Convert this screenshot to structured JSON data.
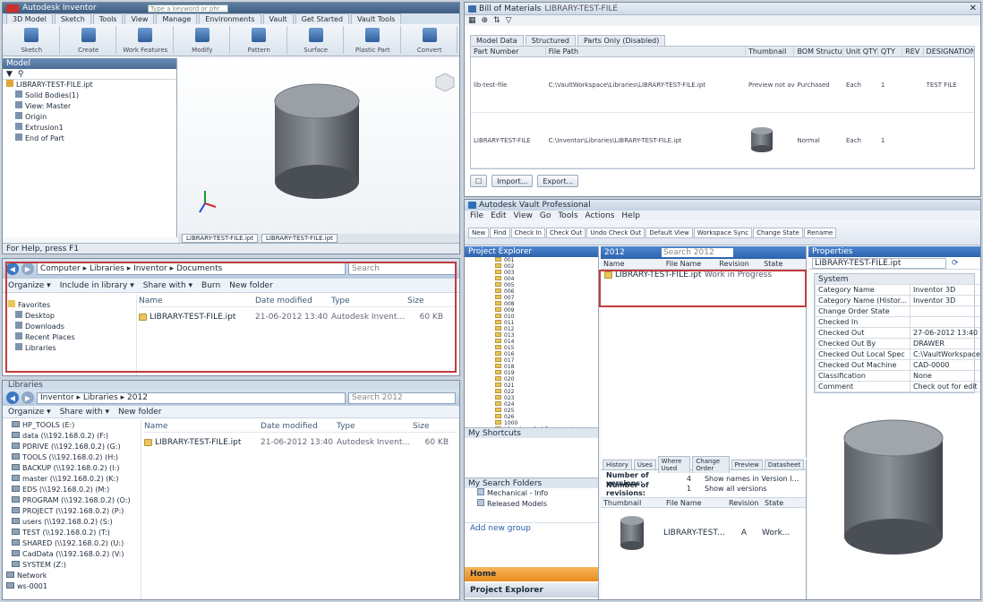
{
  "inventor": {
    "title": "Autodesk Inventor",
    "search_placeholder": "Type a keyword or phrase",
    "ribbon_tabs": [
      "3D Model",
      "Sketch",
      "Tools",
      "View",
      "Manage",
      "Environments",
      "Vault",
      "Get Started",
      "Vault Tools"
    ],
    "ribbon_groups": [
      "Sketch",
      "Create",
      "Work Features",
      "Modify",
      "Pattern",
      "Surface",
      "Plastic Part",
      "Convert"
    ],
    "browser_title": "Model",
    "browser_items": [
      "LIBRARY-TEST-FILE.ipt",
      "Solid Bodies(1)",
      "View: Master",
      "Origin",
      "Extrusion1",
      "End of Part"
    ],
    "doc_tabs": [
      "LIBRARY-TEST-FILE.ipt",
      "LIBRARY-TEST-FILE.ipt"
    ],
    "status": "For Help, press F1"
  },
  "bom": {
    "title": "Bill of Materials",
    "subtitle": "LIBRARY-TEST-FILE",
    "tabs": [
      "Model Data",
      "Structured",
      "Parts Only (Disabled)"
    ],
    "columns": [
      "Part Number",
      "File Path",
      "Thumbnail",
      "BOM Structure",
      "Unit QTY",
      "QTY",
      "REV",
      "DESIGNATION"
    ],
    "rows": [
      {
        "part": "lib-test-file",
        "path": "C:\\VaultWorkspace\\Libraries\\LIBRARY-TEST-FILE.ipt",
        "thumb": "Preview not available",
        "structure": "Purchased",
        "unit": "Each",
        "qty": "1",
        "rev": "",
        "desig": "TEST FILE"
      },
      {
        "part": "LIBRARY-TEST-FILE",
        "path": "C:\\Inventor\\Libraries\\LIBRARY-TEST-FILE.ipt",
        "thumb": "",
        "structure": "Normal",
        "unit": "Each",
        "qty": "1",
        "rev": "",
        "desig": ""
      }
    ],
    "buttons": [
      "Import...",
      "Export..."
    ]
  },
  "explorer1": {
    "address": "Computer ▸ Libraries ▸ Inventor ▸ Documents",
    "search": "Search",
    "toolbar": [
      "Organize ▾",
      "Include in library ▾",
      "Share with ▾",
      "Burn",
      "New folder"
    ],
    "nav": [
      "Favorites",
      "Desktop",
      "Downloads",
      "Recent Places",
      "Libraries"
    ],
    "columns": [
      "Name",
      "Date modified",
      "Type",
      "Size"
    ],
    "file": {
      "name": "LIBRARY-TEST-FILE.ipt",
      "date": "21-06-2012 13:40",
      "type": "Autodesk Inventor...",
      "size": "60 KB"
    }
  },
  "explorer2": {
    "title": "Libraries",
    "address": "Inventor ▸ Libraries ▸ 2012",
    "search": "Search 2012",
    "toolbar": [
      "Organize ▾",
      "Share with ▾",
      "New folder"
    ],
    "nav": [
      "HP_TOOLS (E:)",
      "data (\\\\192.168.0.2) (F:)",
      "PDRIVE (\\\\192.168.0.2) (G:)",
      "TOOLS (\\\\192.168.0.2) (H:)",
      "BACKUP (\\\\192.168.0.2) (I:)",
      "master (\\\\192.168.0.2) (K:)",
      "EDS (\\\\192.168.0.2) (M:)",
      "PROGRAM (\\\\192.168.0.2) (O:)",
      "PROJECT (\\\\192.168.0.2) (P:)",
      "users (\\\\192.168.0.2) (S:)",
      "TEST (\\\\192.168.0.2) (T:)",
      "SHARED (\\\\192.168.0.2) (U:)",
      "CadData (\\\\192.168.0.2) (V:)",
      "SYSTEM (Z:)",
      "Network",
      "ws-0001"
    ],
    "columns": [
      "Name",
      "Date modified",
      "Type",
      "Size"
    ],
    "file": {
      "name": "LIBRARY-TEST-FILE.ipt",
      "date": "21-06-2012 13:40",
      "type": "Autodesk Inventor...",
      "size": "60 KB"
    }
  },
  "vault": {
    "title": "Autodesk Vault Professional",
    "menu": [
      "File",
      "Edit",
      "View",
      "Go",
      "Tools",
      "Actions",
      "Help"
    ],
    "toolbar": [
      "New",
      "Find",
      "Check In",
      "Check Out",
      "Undo Check Out",
      "Default View",
      "Workspace Sync",
      "Change State",
      "Rename"
    ],
    "nav_title": "Project Explorer",
    "folders": [
      "001",
      "002",
      "003",
      "004",
      "005",
      "006",
      "007",
      "008",
      "009",
      "010",
      "011",
      "012",
      "013",
      "014",
      "015",
      "016",
      "017",
      "018",
      "019",
      "020",
      "021",
      "022",
      "023",
      "024",
      "025",
      "026",
      "1000",
      "Libraries - Cad Documents"
    ],
    "my_shortcuts": "My Shortcuts",
    "my_search": "My Search Folders",
    "search_items": [
      "Mechanical - Info",
      "Released Models"
    ],
    "add_group": "Add new group",
    "bottom_tabs": [
      "Home",
      "Project Explorer"
    ],
    "list_title": "2012",
    "search_field": "Search 2012",
    "list_columns": [
      "Name",
      "File Name",
      "Revision",
      "State"
    ],
    "list_row": {
      "name": "LIBRARY-TEST-FILE.ipt",
      "state": "Work in Progress"
    },
    "detail_tabs": [
      "History",
      "Uses",
      "Where Used",
      "Change Order",
      "Preview",
      "Datasheet"
    ],
    "versions": {
      "label1": "Number of versions:",
      "val1": "4",
      "label2": "Number of revisions:",
      "val2": "1",
      "opt1": "Show names in Version list",
      "opt2": "Show all versions"
    },
    "hist_columns": [
      "Thumbnail",
      "File Name",
      "Revision",
      "State"
    ],
    "hist_row": {
      "name": "LIBRARY-TEST-FILE.ipt",
      "rev": "A",
      "state": "Work..."
    },
    "props_title": "Properties",
    "props_file": "LIBRARY-TEST-FILE.ipt",
    "props_group": "System",
    "props": [
      [
        "Category Name",
        "Inventor 3D"
      ],
      [
        "Category Name (Histor...",
        "Inventor 3D"
      ],
      [
        "Change Order State",
        ""
      ],
      [
        "Checked In",
        ""
      ],
      [
        "Checked Out",
        "27-06-2012 13:40"
      ],
      [
        "Checked Out By",
        "DRAWER"
      ],
      [
        "Checked Out Local Spec",
        "C:\\VaultWorkspace\\Libra..."
      ],
      [
        "Checked Out Machine",
        "CAD-0000"
      ],
      [
        "Classification",
        "None"
      ],
      [
        "Comment",
        "Check out for edit"
      ]
    ]
  },
  "colors": {
    "title_bar": "#cfdcea",
    "vault_orange": "#f0a032",
    "selection": "#3d7ad6",
    "highlight": "#c23b3b"
  }
}
